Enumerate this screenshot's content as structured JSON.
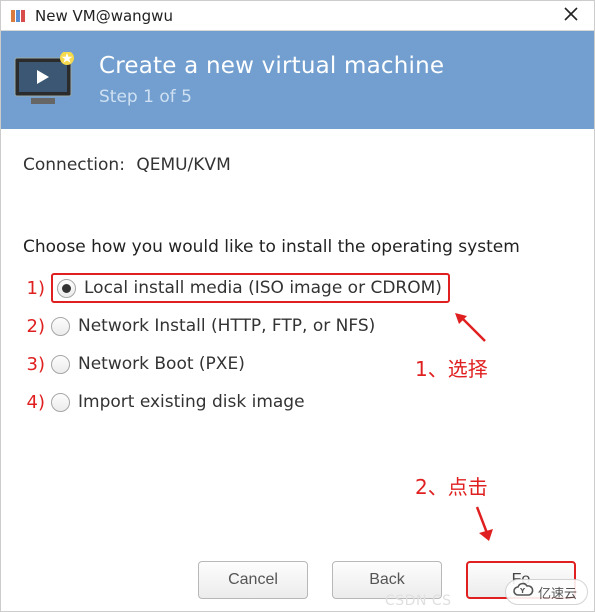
{
  "titlebar": {
    "title": "New VM@wangwu"
  },
  "banner": {
    "heading": "Create a new virtual machine",
    "step": "Step 1 of 5"
  },
  "connection": {
    "label": "Connection:",
    "value": "QEMU/KVM"
  },
  "prompt": "Choose how you would like to install the operating system",
  "options": [
    {
      "num": "1)",
      "label": "Local install media (ISO image or CDROM)",
      "checked": true
    },
    {
      "num": "2)",
      "label": "Network Install (HTTP, FTP, or NFS)",
      "checked": false
    },
    {
      "num": "3)",
      "label": "Network Boot (PXE)",
      "checked": false
    },
    {
      "num": "4)",
      "label": "Import existing disk image",
      "checked": false
    }
  ],
  "annotations": {
    "select": "1、选择",
    "click": "2、点击"
  },
  "buttons": {
    "cancel": "Cancel",
    "back": "Back",
    "forward": "Fo"
  },
  "watermark": {
    "text": "亿速云"
  }
}
